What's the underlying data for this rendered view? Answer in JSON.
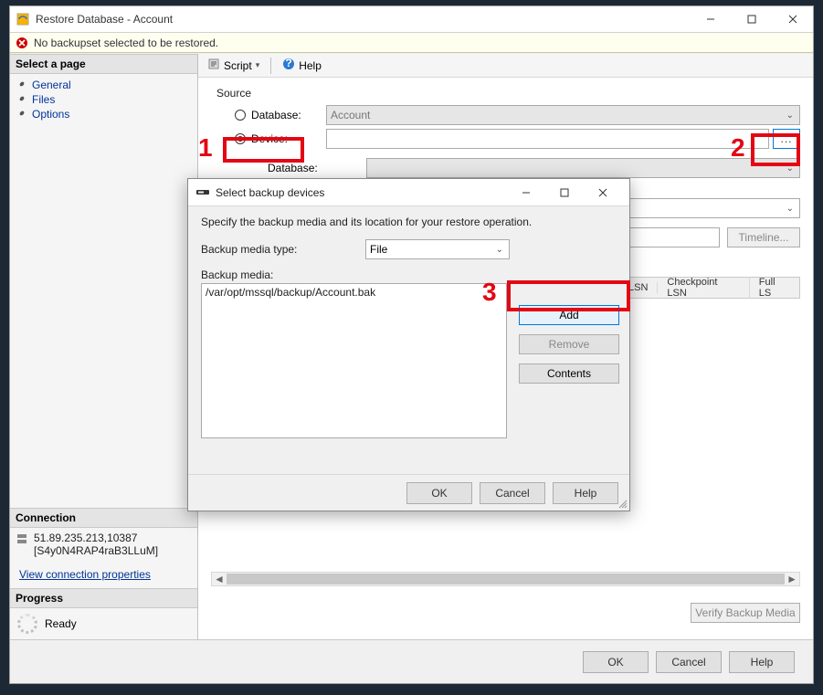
{
  "window": {
    "title": "Restore Database - Account",
    "warn": "No backupset selected to be restored."
  },
  "sidebar": {
    "select_page": "Select a page",
    "pages": [
      "General",
      "Files",
      "Options"
    ],
    "connection_header": "Connection",
    "server": "51.89.235.213,10387",
    "user": "[S4y0N4RAP4raB3LLuM]",
    "view_props": "View connection properties",
    "progress_header": "Progress",
    "progress_status": "Ready"
  },
  "toolbar": {
    "script": "Script",
    "help": "Help"
  },
  "source": {
    "header": "Source",
    "database_radio": "Database:",
    "device_radio": "Device:",
    "db_value": "Account",
    "db_label": "Database:"
  },
  "restore": {
    "timeline": "Timeline..."
  },
  "table": {
    "cols": [
      "LSN",
      "Checkpoint LSN",
      "Full LS"
    ]
  },
  "verify_btn": "Verify Backup Media",
  "footer": {
    "ok": "OK",
    "cancel": "Cancel",
    "help": "Help"
  },
  "dialog": {
    "title": "Select backup devices",
    "desc": "Specify the backup media and its location for your restore operation.",
    "media_type_label": "Backup media type:",
    "media_type_value": "File",
    "media_label": "Backup media:",
    "media_item": "/var/opt/mssql/backup/Account.bak",
    "btn_add": "Add",
    "btn_remove": "Remove",
    "btn_contents": "Contents",
    "ok": "OK",
    "cancel": "Cancel",
    "help": "Help"
  },
  "annotations": {
    "a1": "1",
    "a2": "2",
    "a3": "3"
  }
}
